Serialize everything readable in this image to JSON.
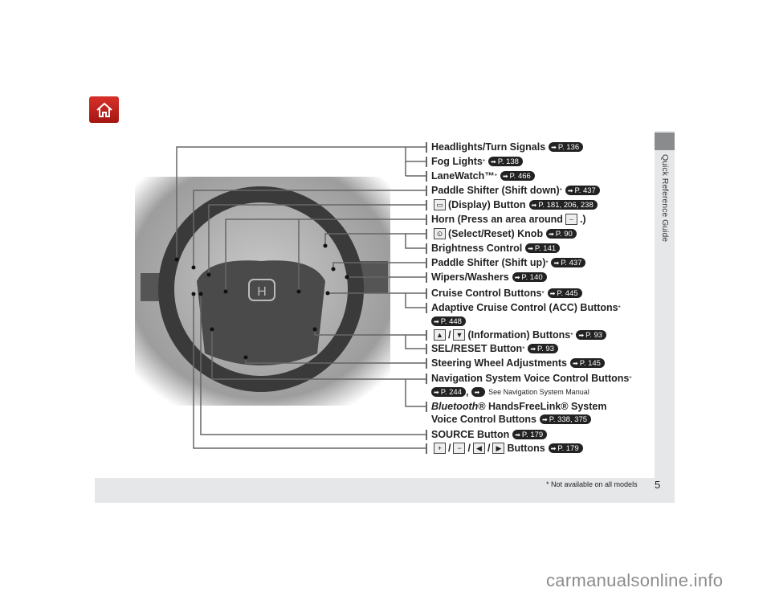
{
  "page": {
    "number": "5",
    "section": "Quick Reference Guide",
    "footnote": "* Not available on all models",
    "watermark": "carmanualsonline.info"
  },
  "icons": {
    "home": "home-icon"
  },
  "items": [
    {
      "label": "Headlights/Turn Signals",
      "ref": "P. 136"
    },
    {
      "label": "Fog Lights",
      "ast": "*",
      "ref": "P. 138"
    },
    {
      "label": "LaneWatch™",
      "ast": "*",
      "ref": "P. 466"
    },
    {
      "label": "Paddle Shifter (Shift down)",
      "ast": "*",
      "ref": "P. 437"
    },
    {
      "label": "(Display) Button",
      "ref": "P. 181, 206, 238"
    },
    {
      "label": "Horn (Press an area around",
      "suffix": ".)"
    },
    {
      "label": "(Select/Reset) Knob",
      "ref": "P. 90"
    },
    {
      "label": "Brightness Control",
      "ref": "P. 141"
    },
    {
      "label": "Paddle Shifter (Shift up)",
      "ast": "*",
      "ref": "P. 437"
    },
    {
      "label": "Wipers/Washers",
      "ref": "P. 140"
    },
    {
      "label": "Cruise Control Buttons",
      "ast": "*",
      "ref": "P. 445"
    },
    {
      "label": "Adaptive Cruise Control (ACC) Buttons",
      "ast": "*",
      "ref": "P. 448"
    },
    {
      "label": "(Information) Buttons",
      "ast": "*",
      "ref": "P. 93"
    },
    {
      "label": "SEL/RESET Button",
      "ast": "*",
      "ref": "P. 93"
    },
    {
      "label": "Steering Wheel Adjustments",
      "ref": "P. 145"
    },
    {
      "label": "Navigation System Voice Control Buttons",
      "ast": "*",
      "ref": "P. 244",
      "extra": "See Navigation System Manual"
    },
    {
      "label_italic": "Bluetooth",
      "label": "® HandsFreeLink® System",
      "label2": "Voice Control Buttons",
      "ref": "P. 338, 375"
    },
    {
      "label": "SOURCE Button",
      "ref": "P. 179"
    },
    {
      "label": "Buttons",
      "ref": "P. 179",
      "sep": "/"
    }
  ]
}
